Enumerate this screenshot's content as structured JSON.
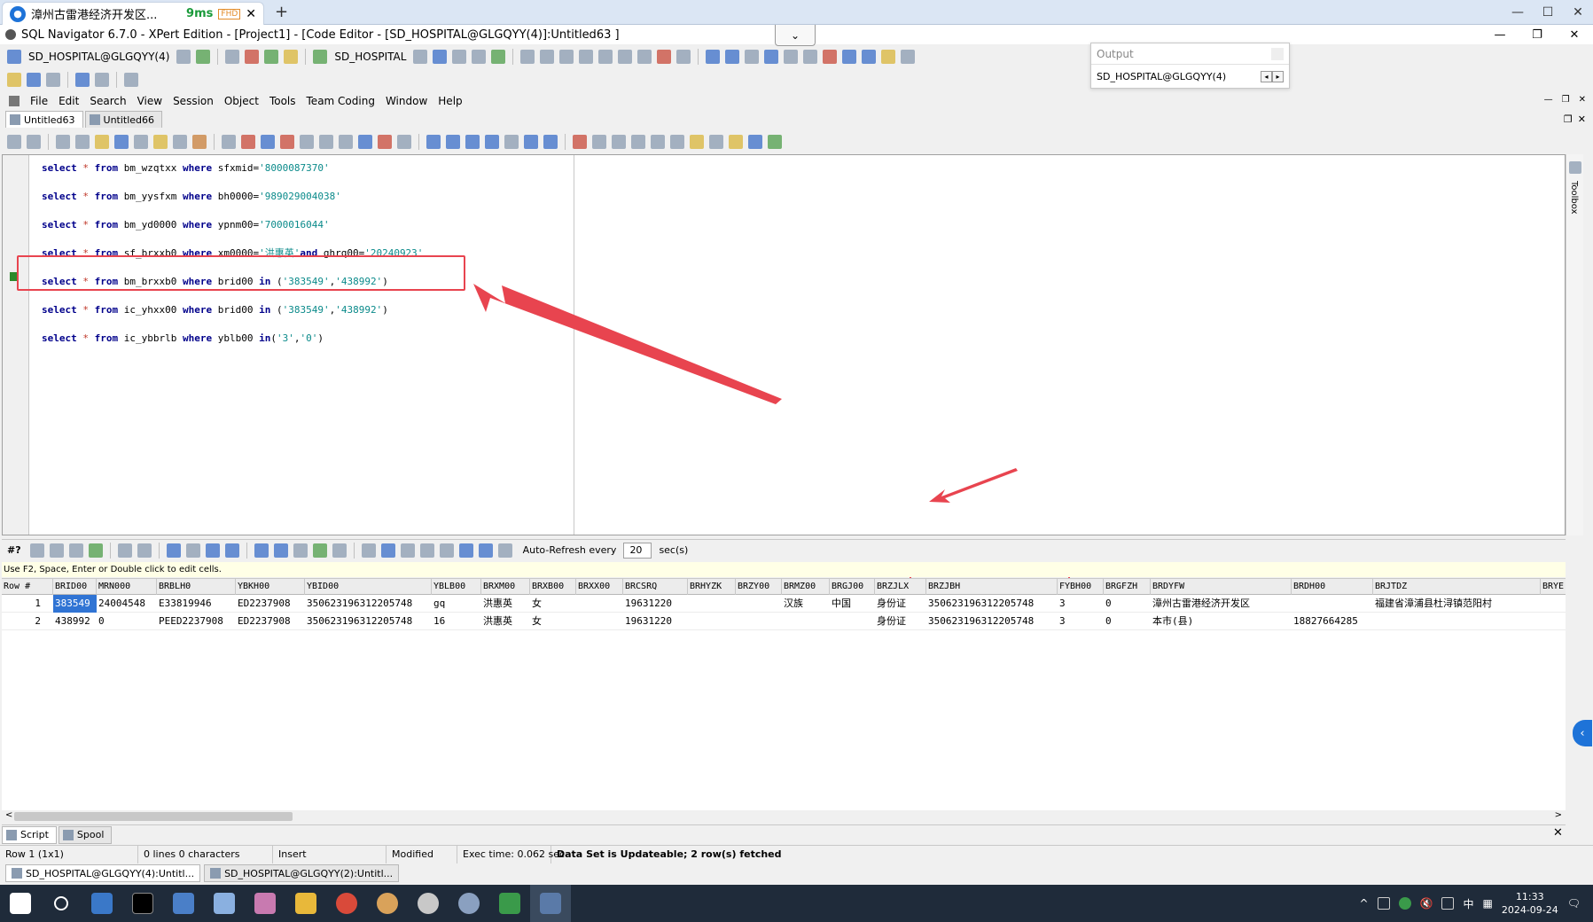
{
  "browser": {
    "tab_title": "漳州古雷港经济开发区...",
    "ping": "9ms",
    "quality_badge": "FHD",
    "close": "✕",
    "new_tab": "+"
  },
  "window": {
    "minimize": "—",
    "restore": "☐",
    "close": "✕"
  },
  "app": {
    "title": "SQL Navigator 6.7.0 - XPert Edition - [Project1] - [Code Editor - [SD_HOSPITAL@GLGQYY(4)]:Untitled63 ]",
    "collapse": "⌄",
    "min": "—",
    "restore": "❐",
    "close": "✕"
  },
  "toolbar1": {
    "connection": "SD_HOSPITAL@GLGQYY(4)",
    "schema": "SD_HOSPITAL"
  },
  "output_panel": {
    "title": "Output",
    "connection": "SD_HOSPITAL@GLGQYY(4)",
    "left": "◂",
    "right": "▸"
  },
  "menu": {
    "items": [
      "File",
      "Edit",
      "Search",
      "View",
      "Session",
      "Object",
      "Tools",
      "Team Coding",
      "Window",
      "Help"
    ],
    "ctl_min": "—",
    "ctl_restore": "❐",
    "ctl_close": "✕"
  },
  "doc_tabs": [
    "Untitled63",
    "Untitled66"
  ],
  "doc_tab_ctl": {
    "restore": "❐",
    "close": "✕"
  },
  "editor": {
    "lines": [
      [
        [
          "kw",
          "select"
        ],
        [
          "op",
          " * "
        ],
        [
          "kw",
          "from"
        ],
        [
          "",
          " bm_wzqtxx "
        ],
        [
          "kw",
          "where"
        ],
        [
          "",
          " sfxmid="
        ],
        [
          "str",
          "'8000087370'"
        ]
      ],
      [
        [
          "kw",
          "select"
        ],
        [
          "op",
          " * "
        ],
        [
          "kw",
          "from"
        ],
        [
          "",
          " bm_yysfxm "
        ],
        [
          "kw",
          "where"
        ],
        [
          "",
          " bh0000="
        ],
        [
          "str",
          "'989029004038'"
        ]
      ],
      [
        [
          "kw",
          "select"
        ],
        [
          "op",
          " * "
        ],
        [
          "kw",
          "from"
        ],
        [
          "",
          " bm_yd0000 "
        ],
        [
          "kw",
          "where"
        ],
        [
          "",
          " ypnm00="
        ],
        [
          "str",
          "'7000016044'"
        ]
      ],
      [
        [
          "kw",
          "select"
        ],
        [
          "op",
          " * "
        ],
        [
          "kw",
          "from"
        ],
        [
          "",
          " sf_brxxb0 "
        ],
        [
          "kw",
          "where"
        ],
        [
          "",
          " xm0000="
        ],
        [
          "str",
          "'洪惠英'"
        ],
        [
          "kw",
          "and"
        ],
        [
          "",
          " ghrq00="
        ],
        [
          "str",
          "'20240923'"
        ]
      ],
      [
        [
          "kw",
          "select"
        ],
        [
          "op",
          " * "
        ],
        [
          "kw",
          "from"
        ],
        [
          "",
          " bm_brxxb0 "
        ],
        [
          "kw",
          "where"
        ],
        [
          "",
          " brid00 "
        ],
        [
          "kw",
          "in"
        ],
        [
          "",
          " ("
        ],
        [
          "str",
          "'383549'"
        ],
        [
          "",
          ","
        ],
        [
          "str",
          "'438992'"
        ],
        [
          "",
          ")"
        ]
      ],
      [
        [
          "kw",
          "select"
        ],
        [
          "op",
          " * "
        ],
        [
          "kw",
          "from"
        ],
        [
          "",
          " ic_yhxx00 "
        ],
        [
          "kw",
          "where"
        ],
        [
          "",
          " brid00 "
        ],
        [
          "kw",
          "in"
        ],
        [
          "",
          " ("
        ],
        [
          "str",
          "'383549'"
        ],
        [
          "",
          ","
        ],
        [
          "str",
          "'438992'"
        ],
        [
          "",
          ")"
        ]
      ],
      [
        [
          "kw",
          "select"
        ],
        [
          "op",
          " * "
        ],
        [
          "kw",
          "from"
        ],
        [
          "",
          " ic_ybbrlb "
        ],
        [
          "kw",
          "where"
        ],
        [
          "",
          " yblb00 "
        ],
        [
          "kw",
          "in"
        ],
        [
          "",
          "("
        ],
        [
          "str",
          "'3'"
        ],
        [
          "",
          ","
        ],
        [
          "str",
          "'0'"
        ],
        [
          "",
          ")"
        ]
      ]
    ],
    "toolbox_label": "Toolbox"
  },
  "grid_toolbar": {
    "row_indicator": "#?",
    "auto_refresh_label": "Auto-Refresh every",
    "auto_refresh_value": "20",
    "unit": "sec(s)"
  },
  "grid": {
    "hint": "Use F2, Space, Enter or Double click to edit cells.",
    "columns": [
      "Row #",
      "BRID00",
      "MRN000",
      "BRBLH0",
      "YBKH00",
      "YBID00",
      "YBLB00",
      "BRXM00",
      "BRXB00",
      "BRXX00",
      "BRCSRQ",
      "BRHYZK",
      "BRZY00",
      "BRMZ00",
      "BRGJ00",
      "BRZJLX",
      "BRZJBH",
      "FYBH00",
      "BRGFZH",
      "BRDYFW",
      "BRDH00",
      "BRJTDZ",
      "BRYE"
    ],
    "rows": [
      [
        "1",
        "383549",
        "24004548",
        "E33819946",
        "ED2237908",
        "350623196312205748",
        "gq",
        "洪惠英",
        "女",
        "",
        "19631220",
        "",
        "",
        "汉族",
        "中国",
        "身份证",
        "350623196312205748",
        "3",
        "0",
        "漳州古雷港经济开发区",
        "",
        "福建省漳浦县杜浔镇范阳村",
        ""
      ],
      [
        "2",
        "438992",
        "0",
        "PEED2237908",
        "ED2237908",
        "350623196312205748",
        "16",
        "洪惠英",
        "女",
        "",
        "19631220",
        "",
        "",
        "",
        "",
        "身份证",
        "350623196312205748",
        "3",
        "0",
        "本市(县)",
        "18827664285",
        "",
        ""
      ]
    ],
    "scroll_left": "<",
    "scroll_right": ">"
  },
  "bottom_tabs": [
    "Script",
    "Spool"
  ],
  "bottom_close": "✕",
  "status": {
    "position": "Row 1 (1x1)",
    "lines": "0 lines 0 characters",
    "mode": "Insert",
    "modified": "Modified",
    "exec_time": "Exec time: 0.062 sec",
    "dataset": "Data Set is Updateable; 2 row(s) fetched"
  },
  "conn_tabs": [
    "SD_HOSPITAL@GLGQYY(4):Untitl...",
    "SD_HOSPITAL@GLGQYY(2):Untitl..."
  ],
  "taskbar": {
    "time": "11:33",
    "date": "2024-09-24",
    "ime": "中",
    "side_collapse": "‹",
    "tray_up": "^",
    "mute": "🔇",
    "grid": "▦",
    "notify": "🗨"
  },
  "colors": {
    "highlight": "#e8444f",
    "selection": "#3074d4",
    "keyword": "#00008b",
    "string": "#0a8a8a"
  }
}
